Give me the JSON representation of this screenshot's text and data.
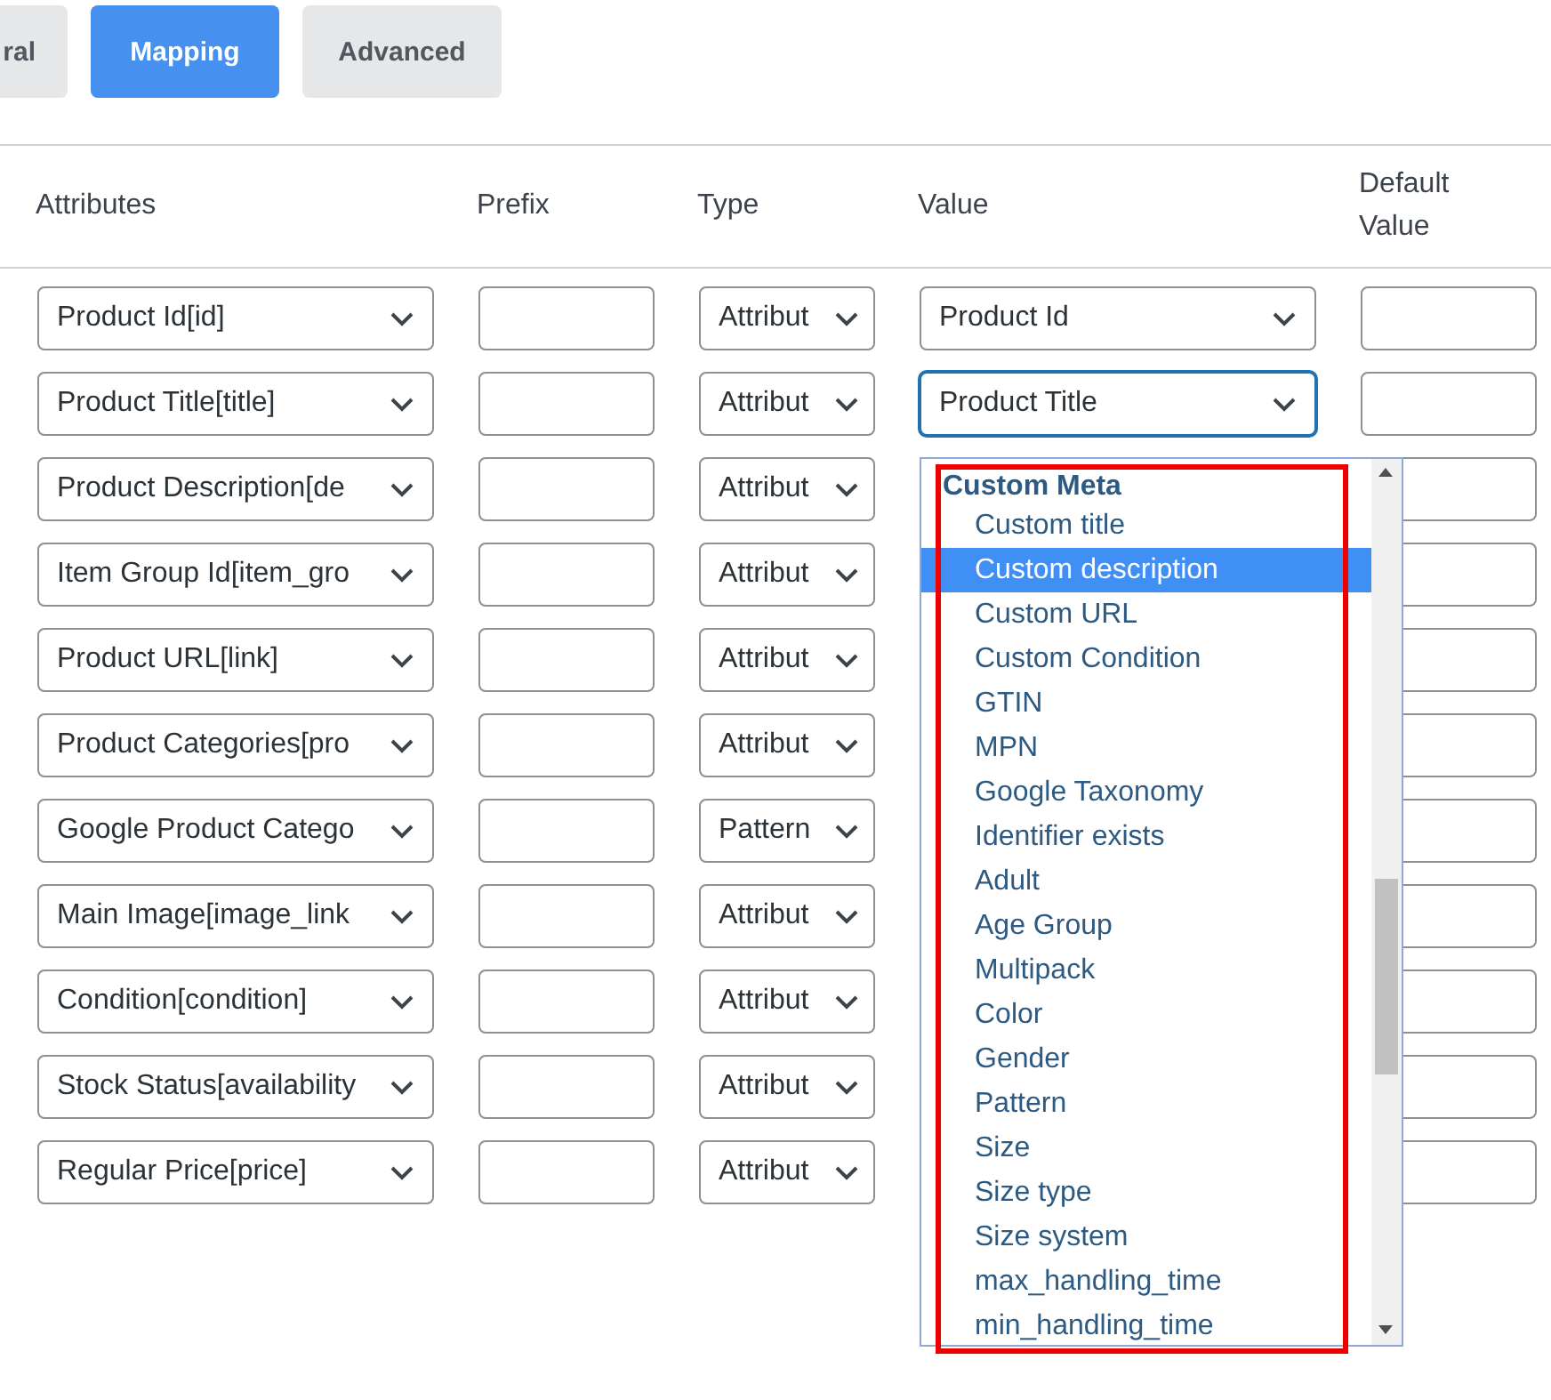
{
  "tabs": [
    {
      "label": "ral",
      "selected": false
    },
    {
      "label": "Mapping",
      "selected": true
    },
    {
      "label": "Advanced",
      "selected": false
    }
  ],
  "columns": [
    "Attributes",
    "Prefix",
    "Type",
    "Value",
    "Default Value"
  ],
  "rows": [
    {
      "attribute": "Product Id[id]",
      "type": "Attribut",
      "value": {
        "text": "Product Id",
        "focused": false
      }
    },
    {
      "attribute": "Product Title[title]",
      "type": "Attribut",
      "value": {
        "text": "Product Title",
        "focused": true
      }
    },
    {
      "attribute": "Product Description[de",
      "type": "Attribut"
    },
    {
      "attribute": "Item Group Id[item_gro",
      "type": "Attribut"
    },
    {
      "attribute": "Product URL[link]",
      "type": "Attribut"
    },
    {
      "attribute": "Product Categories[pro",
      "type": "Attribut"
    },
    {
      "attribute": "Google Product Catego",
      "type": "Pattern"
    },
    {
      "attribute": "Main Image[image_link",
      "type": "Attribut"
    },
    {
      "attribute": "Condition[condition]",
      "type": "Attribut"
    },
    {
      "attribute": "Stock Status[availability",
      "type": "Attribut"
    },
    {
      "attribute": "Regular Price[price]",
      "type": "Attribut"
    }
  ],
  "dropdown": {
    "group": "Custom Meta",
    "annotation": {
      "kind": "highlight-frame"
    },
    "options": [
      {
        "label": "Custom title",
        "selected": false
      },
      {
        "label": "Custom description",
        "selected": true
      },
      {
        "label": "Custom URL",
        "selected": false
      },
      {
        "label": "Custom Condition",
        "selected": false
      },
      {
        "label": "GTIN",
        "selected": false
      },
      {
        "label": "MPN",
        "selected": false
      },
      {
        "label": "Google Taxonomy",
        "selected": false
      },
      {
        "label": "Identifier exists",
        "selected": false
      },
      {
        "label": "Adult",
        "selected": false
      },
      {
        "label": "Age Group",
        "selected": false
      },
      {
        "label": "Multipack",
        "selected": false
      },
      {
        "label": "Color",
        "selected": false
      },
      {
        "label": "Gender",
        "selected": false
      },
      {
        "label": "Pattern",
        "selected": false
      },
      {
        "label": "Size",
        "selected": false
      },
      {
        "label": "Size type",
        "selected": false
      },
      {
        "label": "Size system",
        "selected": false
      },
      {
        "label": "max_handling_time",
        "selected": false
      },
      {
        "label": "min_handling_time",
        "selected": false
      }
    ]
  }
}
